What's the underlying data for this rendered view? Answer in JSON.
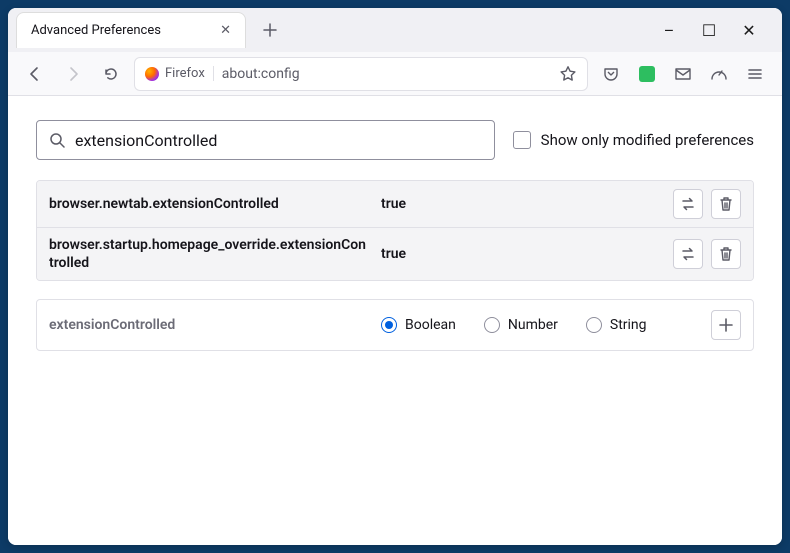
{
  "colors": {
    "accent": "#0060df"
  },
  "titlebar": {
    "tab_title": "Advanced Preferences",
    "win_min": "–",
    "win_max": "☐",
    "win_close": "✕"
  },
  "navbar": {
    "identity_label": "Firefox",
    "url": "about:config"
  },
  "content": {
    "search_value": "extensionControlled",
    "show_modified_label": "Show only modified preferences",
    "prefs": [
      {
        "name": "browser.newtab.extensionControlled",
        "value": "true"
      },
      {
        "name": "browser.startup.homepage_override.extensionControlled",
        "value": "true"
      }
    ],
    "add": {
      "name": "extensionControlled",
      "options": [
        "Boolean",
        "Number",
        "String"
      ],
      "selected": "Boolean"
    }
  }
}
